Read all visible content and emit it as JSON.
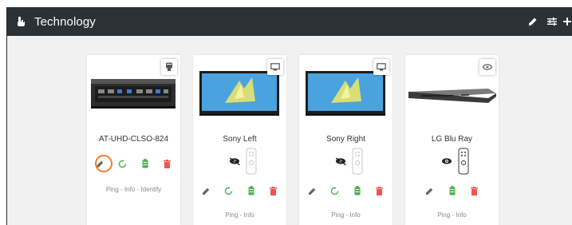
{
  "header": {
    "title": "Technology"
  },
  "devices": [
    {
      "name": "AT-UHD-CLSO-824",
      "type_icon": "processor-icon",
      "links": {
        "ping": "Ping",
        "info": "Info",
        "identify": "Identify",
        "sep": " - "
      }
    },
    {
      "name": "Sony Left",
      "type_icon": "display-icon",
      "visibility": "hidden",
      "links": {
        "ping": "Ping",
        "info": "Info",
        "sep": " - "
      }
    },
    {
      "name": "Sony Right",
      "type_icon": "display-icon",
      "visibility": "hidden",
      "links": {
        "ping": "Ping",
        "info": "Info",
        "sep": " - "
      }
    },
    {
      "name": "LG Blu Ray",
      "type_icon": "disc-icon",
      "visibility": "visible",
      "links": {
        "ping": "Ping",
        "info": "Info",
        "sep": " - "
      }
    }
  ],
  "colors": {
    "header_bg": "#2b3134",
    "edit": "#646464",
    "refresh": "#4caf50",
    "battery": "#4caf50",
    "delete": "#ef5350",
    "highlight": "#f07f2d"
  }
}
